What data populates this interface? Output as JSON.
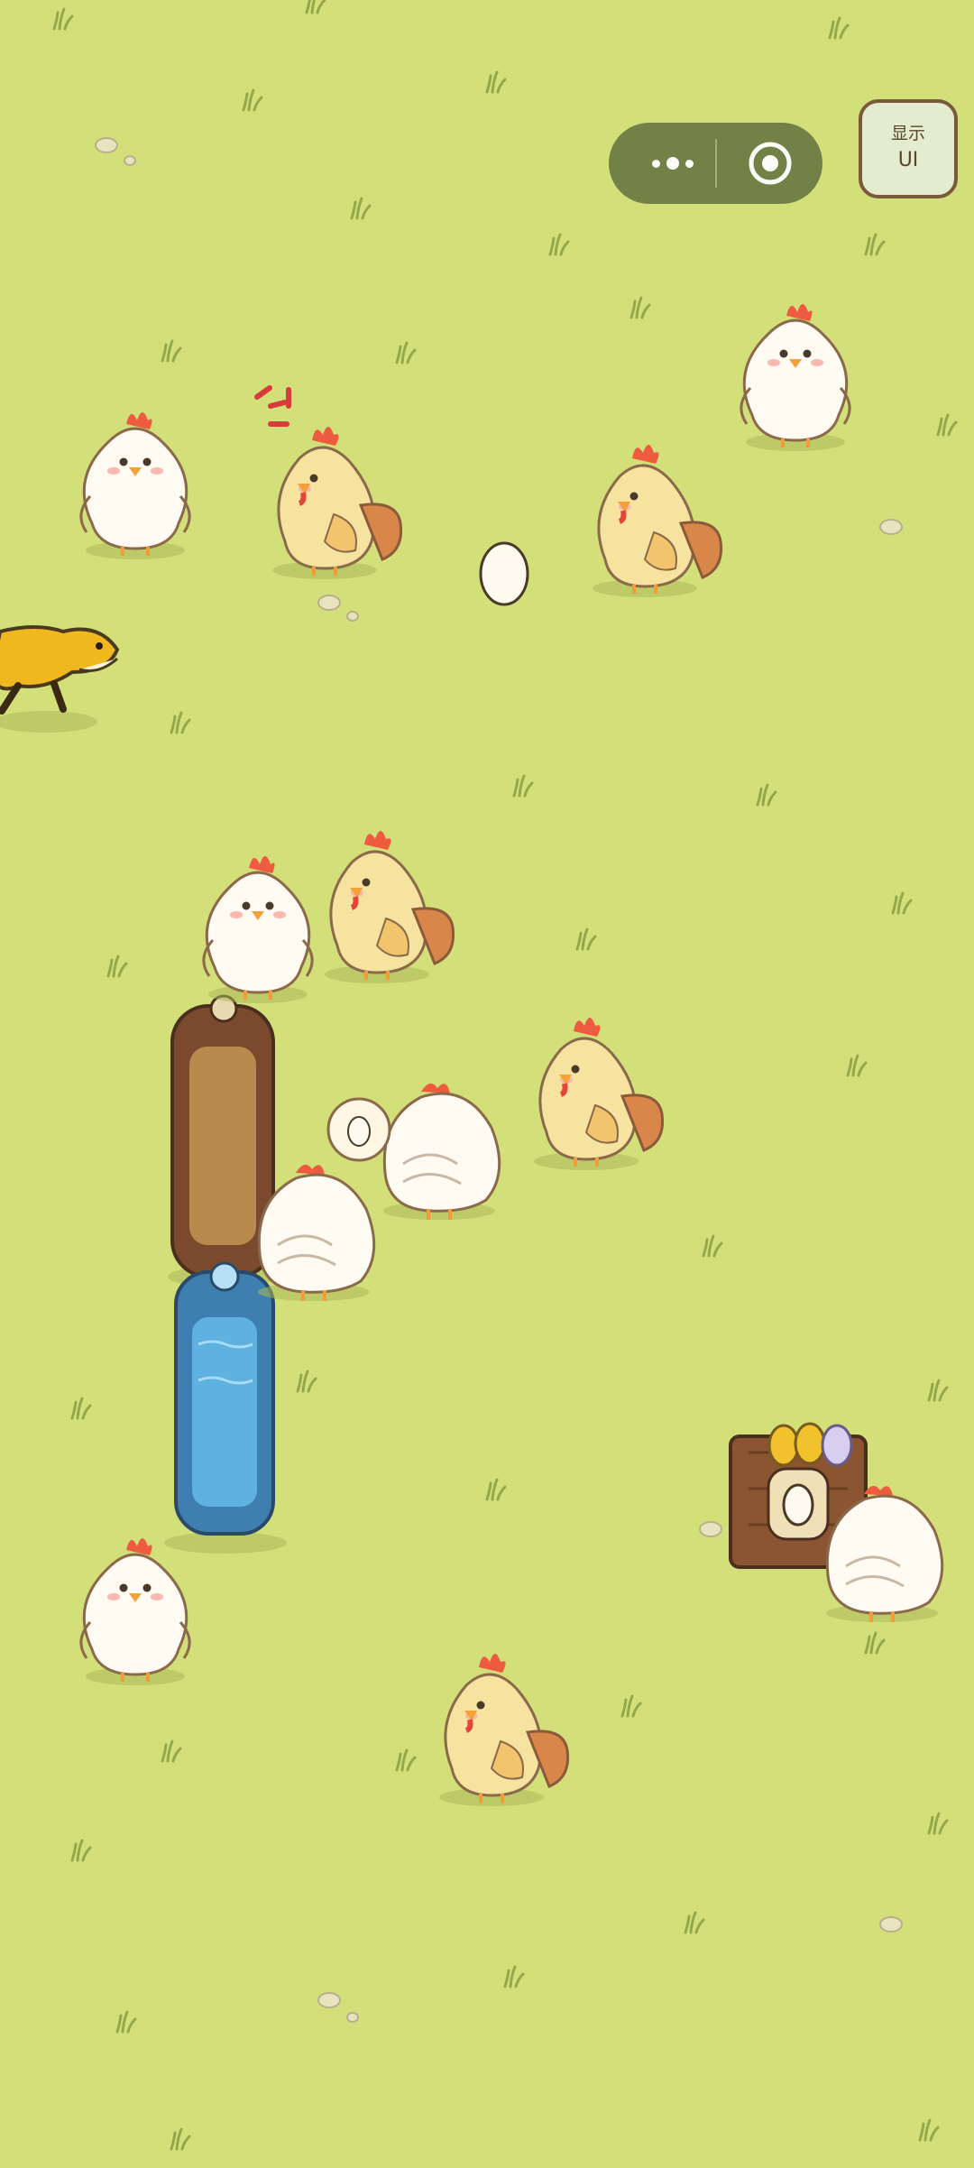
{
  "colors": {
    "grass": "#d3e07a",
    "capsule": "#6d7c43",
    "button_bg": "#e3eccf",
    "button_border": "#7a5a3c",
    "white_chicken": "#fffaf2",
    "yellow_chicken": "#f7e3a0",
    "comb": "#ef5b3e",
    "water": "#5fb2e0",
    "feed": "#b98a4e"
  },
  "hud": {
    "menu_icon": "more-dots-icon",
    "close_icon": "target-circle-icon",
    "show_ui_line1": "显示",
    "show_ui_line2": "UI"
  },
  "scene": {
    "chickens": [
      {
        "kind": "white",
        "mood": "calm"
      },
      {
        "kind": "yellow",
        "mood": "angry"
      },
      {
        "kind": "yellow",
        "mood": "calm"
      },
      {
        "kind": "white",
        "mood": "calm"
      },
      {
        "kind": "white",
        "mood": "sleepy"
      },
      {
        "kind": "yellow",
        "mood": "calm"
      },
      {
        "kind": "white",
        "mood": "back"
      },
      {
        "kind": "yellow",
        "mood": "calm"
      },
      {
        "kind": "white",
        "mood": "back"
      },
      {
        "kind": "white",
        "mood": "calm"
      },
      {
        "kind": "yellow",
        "mood": "calm"
      },
      {
        "kind": "white",
        "mood": "back"
      }
    ],
    "eggs": 1,
    "predator": "weasel",
    "feeder": "feed-trough",
    "water": "water-trough",
    "nest_box_eggs": 3
  }
}
